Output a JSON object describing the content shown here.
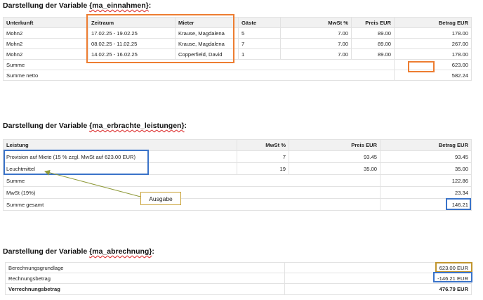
{
  "section1": {
    "heading_prefix": "Darstellung der Variable ",
    "heading_var": "{ma_einnahmen}",
    "heading_suffix": ":",
    "columns": [
      "Unterkunft",
      "Zeitraum",
      "Mieter",
      "Gäste",
      "MwSt %",
      "Preis EUR",
      "Betrag EUR"
    ],
    "rows": [
      {
        "unterkunft": "Mohn2",
        "zeitraum": "17.02.25 - 19.02.25",
        "mieter": "Krause, Magdalena",
        "gaeste": "5",
        "mwst": "7.00",
        "preis": "89.00",
        "betrag": "178.00"
      },
      {
        "unterkunft": "Mohn2",
        "zeitraum": "08.02.25 - 11.02.25",
        "mieter": "Krause, Magdalena",
        "gaeste": "7",
        "mwst": "7.00",
        "preis": "89.00",
        "betrag": "267.00"
      },
      {
        "unterkunft": "Mohn2",
        "zeitraum": "14.02.25 - 16.02.25",
        "mieter": "Copperfield, David",
        "gaeste": "1",
        "mwst": "7.00",
        "preis": "89.00",
        "betrag": "178.00"
      }
    ],
    "summe_label": "Summe",
    "summe_value": "623.00",
    "netto_label": "Summe netto",
    "netto_value": "582.24"
  },
  "section2": {
    "heading_prefix": "Darstellung der Variable ",
    "heading_var": "{ma_erbrachte_leistungen}",
    "heading_suffix": ":",
    "columns": [
      "Leistung",
      "MwSt %",
      "Preis EUR",
      "Betrag EUR"
    ],
    "rows": [
      {
        "leistung": "Provision auf Miete (15 % zzgl. MwSt auf 623.00 EUR)",
        "mwst": "7",
        "preis": "93.45",
        "betrag": "93.45"
      },
      {
        "leistung": "Leuchtmittel",
        "mwst": "19",
        "preis": "35.00",
        "betrag": "35.00"
      }
    ],
    "summe_label": "Summe",
    "summe_value": "122.86",
    "mwst_label": "MwSt (19%)",
    "mwst_value": "23.34",
    "gesamt_label": "Summe gesamt",
    "gesamt_value": "146.21",
    "callout_label": "Ausgabe"
  },
  "section3": {
    "heading_prefix": "Darstellung der Variable ",
    "heading_var": "{ma_abrechnung}",
    "heading_suffix": ":",
    "rows": [
      {
        "label": "Berechnungsgrundlage",
        "value": "623.00 EUR"
      },
      {
        "label": "Rechnungsbetrag",
        "value": "-146.21 EUR"
      }
    ],
    "total_label": "Verrechnungsbetrag",
    "total_value": "476.79 EUR"
  },
  "colors": {
    "orange": "#ed7d31",
    "blue": "#3a73c9",
    "gold": "#c1962f",
    "header_bg": "#f1f1f1"
  }
}
